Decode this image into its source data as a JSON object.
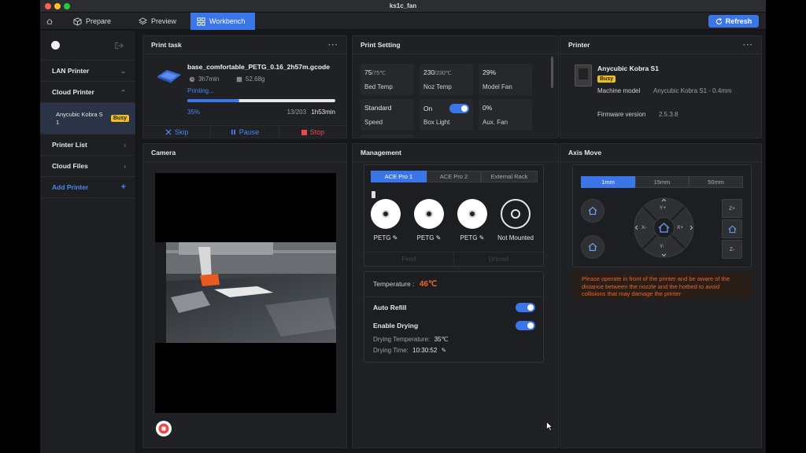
{
  "window": {
    "title": "ks1c_fan"
  },
  "tabs": [
    {
      "label": "Prepare",
      "icon": "home-icon"
    },
    {
      "label": "Prepare",
      "icon": "cube-icon"
    },
    {
      "label": "Preview",
      "icon": "layers-icon"
    },
    {
      "label": "Workbench",
      "icon": "grid-icon"
    }
  ],
  "refresh_label": "Refresh",
  "sidebar": {
    "lan_printer": "LAN Printer",
    "cloud_printer": "Cloud Printer",
    "printer_name": "Anycubic Kobra S 1",
    "busy": "Busy",
    "printer_list": "Printer List",
    "cloud_files": "Cloud Files",
    "add_printer": "Add Printer",
    "add_symbol": "+"
  },
  "print_task": {
    "title": "Print task",
    "filename": "base_comfortable_PETG_0.16_2h57m.gcode",
    "duration": "3h7min",
    "weight": "52.68g",
    "status": "Printing...",
    "percent": "35%",
    "progress": 0.35,
    "layers": "13/203",
    "remaining": "1h53min",
    "skip": "Skip",
    "pause": "Pause",
    "stop": "Stop"
  },
  "print_setting": {
    "title": "Print Setting",
    "bed_temp_value": "75",
    "bed_temp_target": "/75℃",
    "bed_temp_label": "Bed Temp",
    "noz_temp_value": "230",
    "noz_temp_target": "/230℃",
    "noz_temp_label": "Noz Temp",
    "model_fan_value": "29%",
    "model_fan_label": "Model Fan",
    "speed_value": "Standard",
    "speed_label": "Speed",
    "box_light_value": "On",
    "box_light_label": "Box Light",
    "aux_fan_value": "0%",
    "aux_fan_label": "Aux. Fan"
  },
  "printer": {
    "title": "Printer",
    "name": "Anycubic Kobra S1",
    "busy": "Busy",
    "model_label": "Machine model",
    "model_value": "Anycubic Kobra S1 - 0.4mm",
    "firmware_label": "Firmware version",
    "firmware_value": "2.5.3.8"
  },
  "camera": {
    "title": "Camera"
  },
  "management": {
    "title": "Management",
    "tabs": [
      "ACE Pro 1",
      "ACE Pro 2",
      "External Rack"
    ],
    "spools": [
      "PETG",
      "PETG",
      "PETG",
      "Not Mounted"
    ],
    "feed": "Feed",
    "unload": "Unload",
    "temperature_label": "Temperature :",
    "temperature_value": "46℃",
    "auto_refill": "Auto Refill",
    "enable_drying": "Enable Drying",
    "drying_temp_label": "Drying Temperature:",
    "drying_temp_value": "35℃",
    "drying_time_label": "Drying Time:",
    "drying_time_value": "10:30:52"
  },
  "axis_move": {
    "title": "Axis Move",
    "steps": [
      "1mm",
      "15mm",
      "50mm"
    ],
    "y_plus": "Y+",
    "y_minus": "Y-",
    "x_plus": "X+",
    "x_minus": "X-",
    "z_plus": "Z+",
    "z_minus": "Z-",
    "warning": "Please operate in front of the printer and be aware of the distance between the nozzle and the hotbed to avoid collisions that may damage the printer"
  },
  "colors": {
    "accent": "#3a76e8",
    "busy": "#f0c020",
    "stop": "#e84a4a",
    "warning": "#e8662a"
  }
}
